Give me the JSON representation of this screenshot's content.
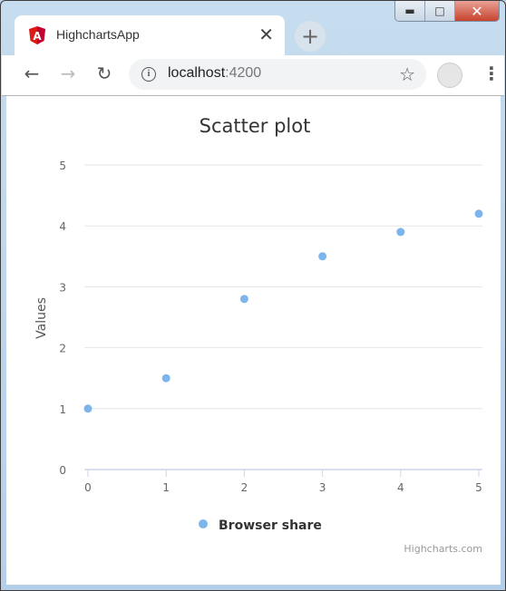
{
  "browser": {
    "tab_title": "HighchartsApp",
    "tab_icon": "angular-icon",
    "url_host": "localhost",
    "url_port": ":4200",
    "window_controls": [
      "minimize",
      "maximize",
      "close"
    ]
  },
  "chart_data": {
    "type": "scatter",
    "title": "Scatter plot",
    "xlabel": "",
    "ylabel": "Values",
    "x": [
      0,
      1,
      2,
      3,
      4,
      5
    ],
    "series": [
      {
        "name": "Browser share",
        "color": "#7cb5ec",
        "points": [
          [
            0,
            1
          ],
          [
            1,
            1.5
          ],
          [
            2,
            2.8
          ],
          [
            3,
            3.5
          ],
          [
            4,
            3.9
          ],
          [
            5,
            4.2
          ]
        ]
      }
    ],
    "xlim": [
      0,
      5
    ],
    "ylim": [
      0,
      5
    ],
    "xticks": [
      "0",
      "1",
      "2",
      "3",
      "4",
      "5"
    ],
    "yticks": [
      "0",
      "1",
      "2",
      "3",
      "4",
      "5"
    ],
    "grid": true,
    "legend": "bottom-center",
    "credits": "Highcharts.com"
  }
}
